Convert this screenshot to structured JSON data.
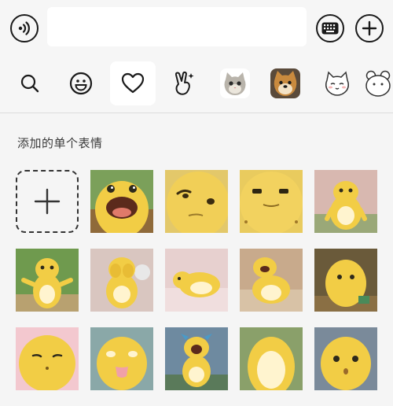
{
  "input_bar": {
    "voice_icon": "voice-waves-icon",
    "keyboard_icon": "keyboard-icon",
    "add_icon": "plus-circle-icon",
    "input_value": ""
  },
  "tabs": [
    {
      "name": "search",
      "icon": "search-icon"
    },
    {
      "name": "emoji",
      "icon": "smile-icon"
    },
    {
      "name": "favorites",
      "icon": "heart-icon",
      "active": true
    },
    {
      "name": "gesture",
      "icon": "peace-hand-icon"
    },
    {
      "name": "sticker-cat",
      "icon": "cat-sticker"
    },
    {
      "name": "sticker-dog",
      "icon": "shiba-sticker"
    },
    {
      "name": "sticker-white-cat",
      "icon": "white-cat-sticker"
    },
    {
      "name": "sticker-more",
      "icon": "bear-sticker"
    }
  ],
  "section": {
    "title": "添加的单个表情"
  },
  "colors": {
    "background": "#f5f5f5",
    "accent_yellow": "#f2cd45",
    "belly": "#fff4cf"
  }
}
